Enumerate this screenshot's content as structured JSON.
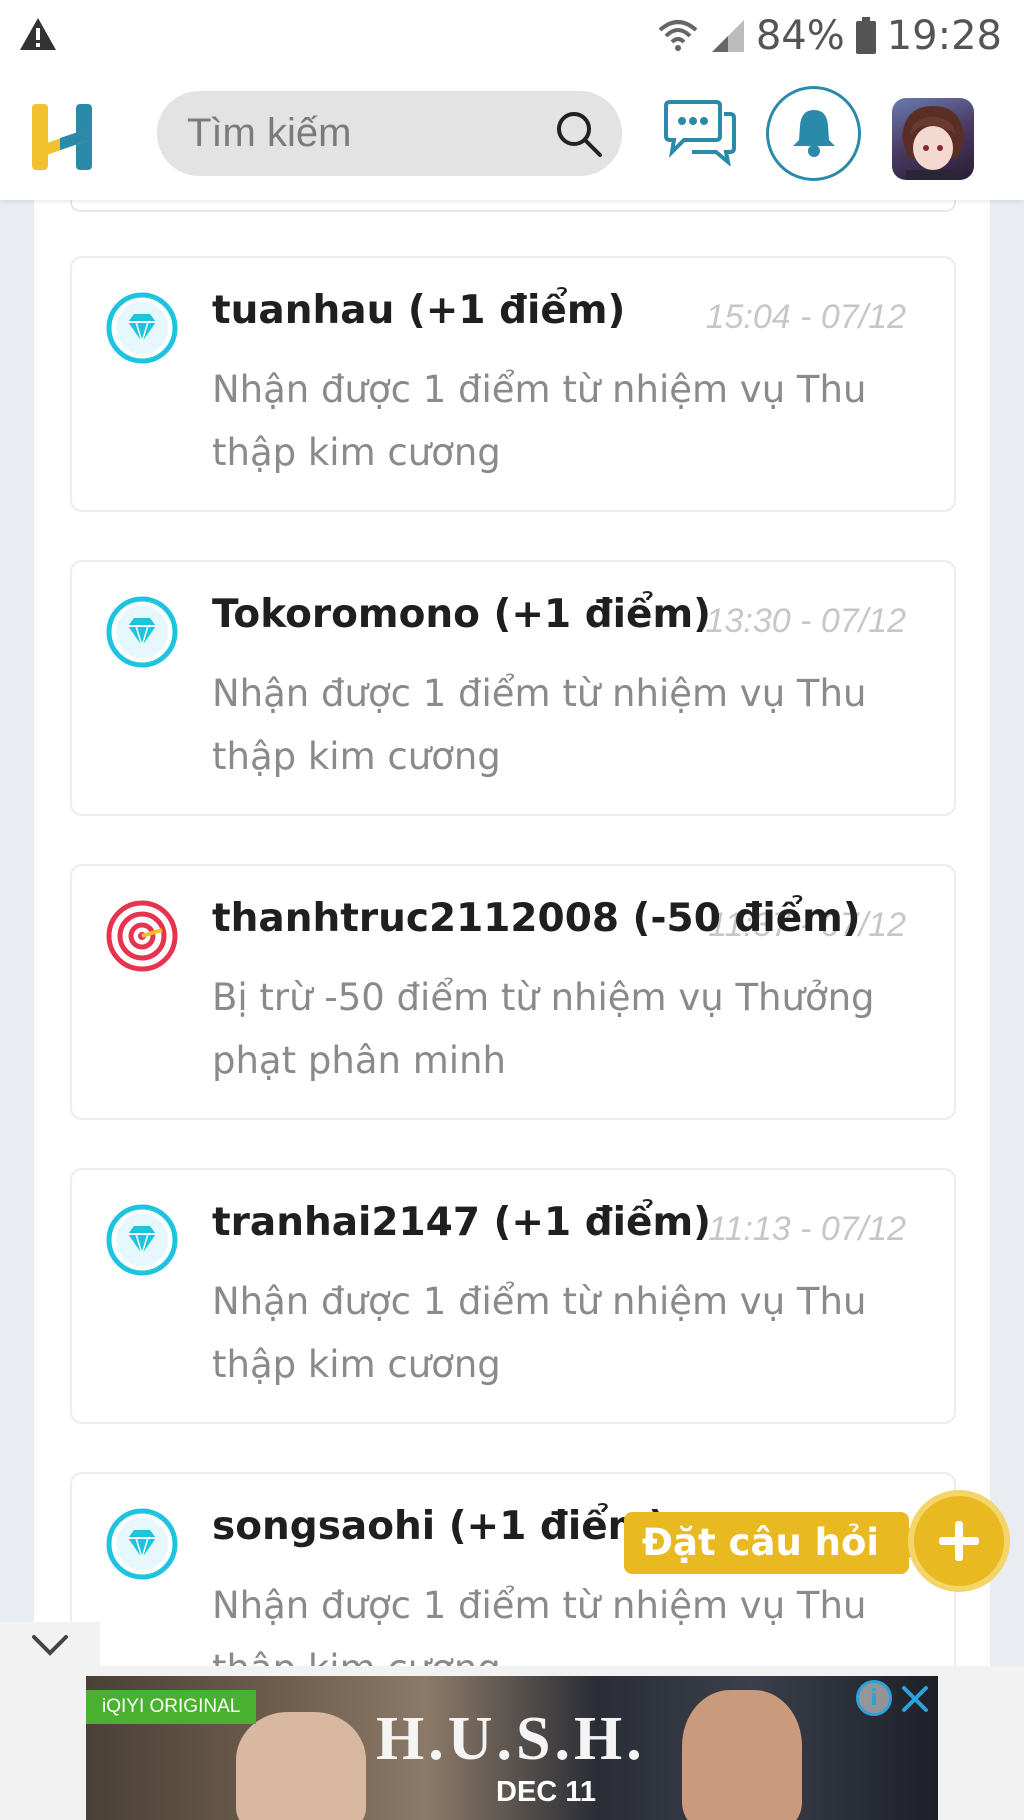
{
  "status_bar": {
    "battery": "84%",
    "time": "19:28"
  },
  "header": {
    "search_placeholder": "Tìm kiếm"
  },
  "notifications": [
    {
      "user": "tuanhau (+1 điểm)",
      "time": "15:04 - 07/12",
      "message": "Nhận được 1 điểm từ nhiệm vụ Thu thập kim cương",
      "icon": "diamond-icon"
    },
    {
      "user": "Tokoromono (+1 điểm)",
      "time": "13:30 - 07/12",
      "message": "Nhận được 1 điểm từ nhiệm vụ Thu thập kim cương",
      "icon": "diamond-icon"
    },
    {
      "user": "thanhtruc2112008 (-50 điểm)",
      "time": "11:37 - 07/12",
      "message": "Bị trừ -50 điểm từ nhiệm vụ Thưởng phạt phân minh",
      "icon": "target-icon"
    },
    {
      "user": "tranhai2147 (+1 điểm)",
      "time": "11:13 - 07/12",
      "message": "Nhận được 1 điểm từ nhiệm vụ Thu thập kim cương",
      "icon": "diamond-icon"
    },
    {
      "user": "songsaohi (+1 điểm)",
      "time": "",
      "message": "Nhận được 1 điểm từ nhiệm vụ Thu thập kim cương",
      "icon": "diamond-icon"
    }
  ],
  "ask_button": {
    "label": "Đặt câu hỏi"
  },
  "ad": {
    "badge": "iQIYI ORIGINAL",
    "title": "H.U.S.H.",
    "date": "DEC 11"
  },
  "colors": {
    "accent_yellow": "#e9b921",
    "brand_teal": "#2b8aa9",
    "diamond_cyan": "#1ec3e0",
    "target_red": "#e8334f"
  }
}
